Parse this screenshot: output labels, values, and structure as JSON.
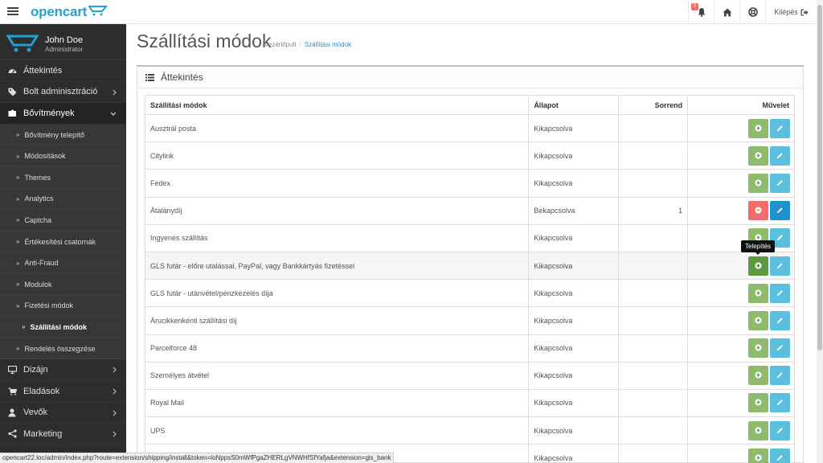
{
  "header": {
    "logo": "opencart",
    "notification_count": "0",
    "logout_label": "Kilépés"
  },
  "sidebar": {
    "user_name": "John Doe",
    "user_role": "Administrator",
    "menu": [
      {
        "label": "Áttekintés",
        "icon": "dashboard-icon"
      },
      {
        "label": "Bolt adminisztráció",
        "icon": "tag-icon"
      },
      {
        "label": "Bővítmények",
        "icon": "puzzle-icon"
      }
    ],
    "submenu": [
      {
        "label": "Bővítmény telepítő"
      },
      {
        "label": "Módosítások"
      },
      {
        "label": "Themes"
      },
      {
        "label": "Analytics"
      },
      {
        "label": "Captcha"
      },
      {
        "label": "Értékesítési csatornák"
      },
      {
        "label": "Anti-Fraud"
      },
      {
        "label": "Modulok"
      },
      {
        "label": "Fizetési módok"
      },
      {
        "label": "Szállítási módok"
      },
      {
        "label": "Rendelés összegzése"
      }
    ],
    "menu_bottom": [
      {
        "label": "Dizájn",
        "icon": "desktop-icon"
      },
      {
        "label": "Eladások",
        "icon": "cart-icon"
      },
      {
        "label": "Vevők",
        "icon": "user-icon"
      },
      {
        "label": "Marketing",
        "icon": "share-icon"
      }
    ]
  },
  "page": {
    "title": "Szállítási módok",
    "breadcrumb": [
      "Vezérlőpult",
      "Szállítási módok"
    ]
  },
  "panel": {
    "title": "Áttekintés"
  },
  "table": {
    "headers": [
      "Szállítási módok",
      "Állapot",
      "Sorrend",
      "Művelet"
    ],
    "rows": [
      {
        "name": "Ausztrál posta",
        "status": "Kikapcsolva",
        "order": ""
      },
      {
        "name": "Citylink",
        "status": "Kikapcsolva",
        "order": ""
      },
      {
        "name": "Fedex",
        "status": "Kikapcsolva",
        "order": ""
      },
      {
        "name": "Átalánydíj",
        "status": "Bekapcsolva",
        "order": "1"
      },
      {
        "name": "Ingyenes szállítás",
        "status": "Kikapcsolva",
        "order": ""
      },
      {
        "name": "GLS futár - előre utalással, PayPal, vagy Bankkártyás fizetéssel",
        "status": "Kikapcsolva",
        "order": ""
      },
      {
        "name": "GLS futár - utánvétel/pénzkezelés díja",
        "status": "Kikapcsolva",
        "order": ""
      },
      {
        "name": "Árucikkenkénti szállítási díj",
        "status": "Kikapcsolva",
        "order": ""
      },
      {
        "name": "Parcelforce 48",
        "status": "Kikapcsolva",
        "order": ""
      },
      {
        "name": "Személyes átvétel",
        "status": "Kikapcsolva",
        "order": ""
      },
      {
        "name": "Royal Mail",
        "status": "Kikapcsolva",
        "order": ""
      },
      {
        "name": "UPS",
        "status": "Kikapcsolva",
        "order": ""
      },
      {
        "name": "",
        "status": "Kikapcsolva",
        "order": ""
      }
    ]
  },
  "tooltip": "Telepítés",
  "statusbar_url": "opencart22.loc/admin/index.php?route=extension/shipping/install&token=loNppsS0mWfPgaZHERLgVNWHfSfYafja&extension=gls_bank",
  "colors": {
    "accent": "#1e91cf",
    "sidebar": "#2d2d2d",
    "install": "#8fbb6c",
    "uninstall": "#f56b6b",
    "edit": "#5bc0de"
  }
}
